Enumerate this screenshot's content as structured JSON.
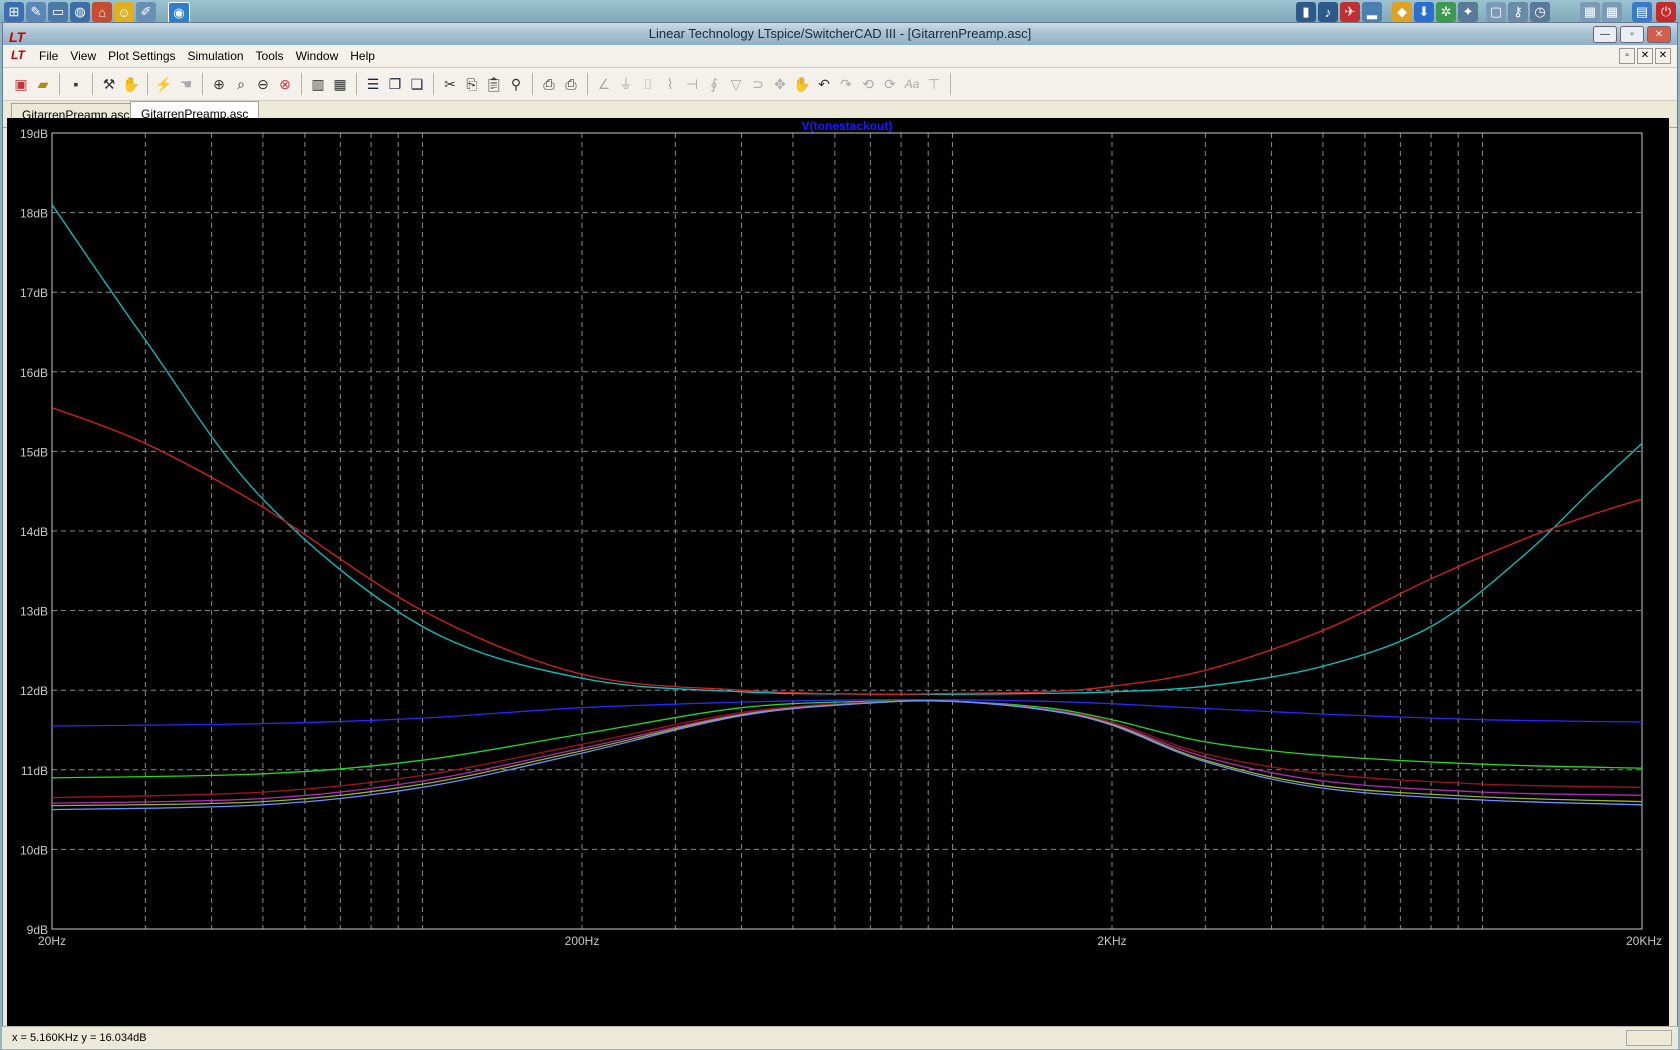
{
  "window": {
    "title": "Linear Technology LTspice/SwitcherCAD III - [GitarrenPreamp.asc]"
  },
  "menu": [
    "File",
    "View",
    "Plot Settings",
    "Simulation",
    "Tools",
    "Window",
    "Help"
  ],
  "tabs": [
    {
      "label": "GitarrenPreamp.asc",
      "active": false
    },
    {
      "label": "GitarrenPreamp.asc",
      "active": true
    }
  ],
  "status": {
    "cursor": "x = 5.160KHz    y = 16.034dB"
  },
  "chart_data": {
    "type": "line",
    "title": "V(tonestackout)",
    "x_scale": "log",
    "x_ticks": [
      "20Hz",
      "200Hz",
      "2KHz",
      "20KHz"
    ],
    "y_ticks": [
      "19dB",
      "18dB",
      "17dB",
      "16dB",
      "15dB",
      "14dB",
      "13dB",
      "12dB",
      "11dB",
      "10dB",
      "9dB"
    ],
    "xlim": [
      20,
      20000
    ],
    "ylim": [
      9,
      19
    ],
    "grid": true,
    "background": "#000000",
    "series": [
      {
        "color": "#00c8c8",
        "x": [
          20,
          30,
          50,
          100,
          200,
          400,
          700,
          1000,
          1500,
          2000,
          3000,
          5000,
          8000,
          12000,
          16000,
          20000
        ],
        "y": [
          18.1,
          16.4,
          14.4,
          12.8,
          12.15,
          11.98,
          11.95,
          11.95,
          11.96,
          11.98,
          12.05,
          12.3,
          12.8,
          13.7,
          14.5,
          15.1
        ]
      },
      {
        "color": "#dc1e1e",
        "x": [
          20,
          30,
          50,
          100,
          200,
          400,
          700,
          1000,
          1500,
          2000,
          3000,
          5000,
          8000,
          12000,
          16000,
          20000
        ],
        "y": [
          15.55,
          15.1,
          14.3,
          13.0,
          12.2,
          12.0,
          11.95,
          11.96,
          11.98,
          12.05,
          12.25,
          12.75,
          13.4,
          13.9,
          14.2,
          14.4
        ]
      },
      {
        "color": "#2828ff",
        "x": [
          20,
          50,
          100,
          200,
          400,
          700,
          1000,
          1500,
          2000,
          3000,
          5000,
          10000,
          20000
        ],
        "y": [
          11.55,
          11.58,
          11.65,
          11.78,
          11.85,
          11.88,
          11.88,
          11.86,
          11.83,
          11.77,
          11.7,
          11.63,
          11.6
        ]
      },
      {
        "color": "#1edc1e",
        "x": [
          20,
          50,
          100,
          200,
          400,
          700,
          1000,
          1500,
          2000,
          3000,
          5000,
          10000,
          20000
        ],
        "y": [
          10.9,
          10.95,
          11.12,
          11.45,
          11.78,
          11.86,
          11.86,
          11.78,
          11.63,
          11.35,
          11.18,
          11.07,
          11.02
        ]
      },
      {
        "color": "#a01414",
        "x": [
          20,
          50,
          100,
          200,
          400,
          700,
          1000,
          1500,
          2000,
          3000,
          5000,
          10000,
          20000
        ],
        "y": [
          10.65,
          10.72,
          10.93,
          11.32,
          11.72,
          11.85,
          11.86,
          11.76,
          11.6,
          11.2,
          10.95,
          10.82,
          10.78
        ]
      },
      {
        "color": "#b428b4",
        "x": [
          20,
          50,
          100,
          200,
          400,
          700,
          1000,
          1500,
          2000,
          3000,
          5000,
          10000,
          20000
        ],
        "y": [
          10.58,
          10.64,
          10.86,
          11.27,
          11.7,
          11.84,
          11.86,
          11.76,
          11.58,
          11.16,
          10.86,
          10.72,
          10.68
        ]
      },
      {
        "color": "#96b428",
        "x": [
          20,
          50,
          100,
          200,
          400,
          700,
          1000,
          1500,
          2000,
          3000,
          5000,
          10000,
          20000
        ],
        "y": [
          10.55,
          10.6,
          10.82,
          11.24,
          11.69,
          11.84,
          11.86,
          11.75,
          11.57,
          11.12,
          10.8,
          10.66,
          10.6
        ]
      },
      {
        "color": "#6496ff",
        "x": [
          20,
          50,
          100,
          200,
          400,
          700,
          1000,
          1500,
          2000,
          3000,
          5000,
          10000,
          20000
        ],
        "y": [
          10.5,
          10.56,
          10.78,
          11.21,
          11.68,
          11.84,
          11.86,
          11.75,
          11.56,
          11.1,
          10.77,
          10.62,
          10.56
        ]
      }
    ]
  }
}
